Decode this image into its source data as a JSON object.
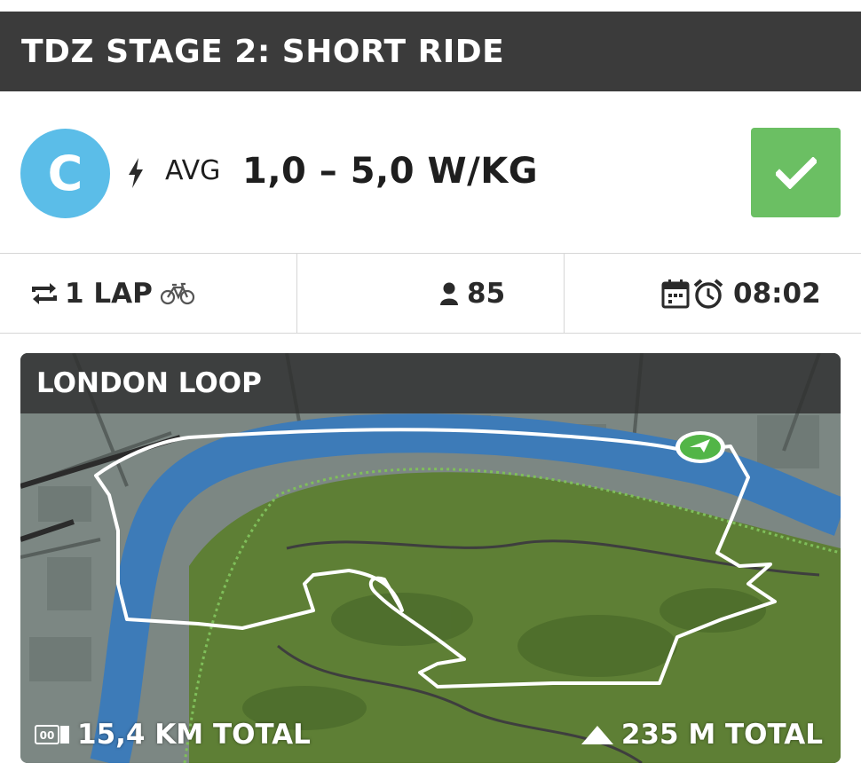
{
  "event": {
    "title": "TDZ STAGE 2: SHORT RIDE"
  },
  "category": {
    "letter": "C",
    "avg_label": "AVG",
    "power_range": "1,0 – 5,0 W/KG",
    "badge_color": "#5bbde8",
    "signed_up": true,
    "check_color": "#6bbf63"
  },
  "stats": {
    "laps": "1 LAP",
    "riders": "85",
    "start_time": "08:02"
  },
  "route": {
    "name": "LONDON LOOP",
    "distance": "15,4 KM TOTAL",
    "elevation": "235 M TOTAL",
    "odometer_glyph": "00"
  },
  "colors": {
    "header_bg": "#3b3b3b",
    "river": "#3d7bb8",
    "park": "#5e7f35"
  }
}
